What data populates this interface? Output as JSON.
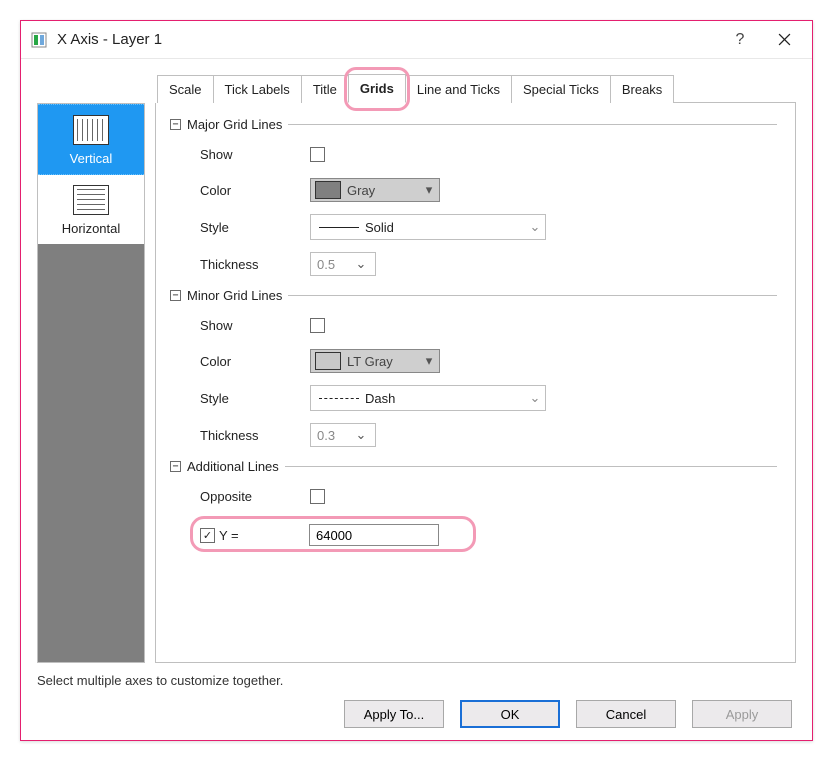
{
  "window": {
    "title": "X Axis - Layer 1"
  },
  "tabs": {
    "scale": "Scale",
    "tick_labels": "Tick Labels",
    "title": "Title",
    "grids": "Grids",
    "line_and_ticks": "Line and Ticks",
    "special_ticks": "Special Ticks",
    "breaks": "Breaks"
  },
  "sidebar": {
    "vertical": "Vertical",
    "horizontal": "Horizontal"
  },
  "groups": {
    "major": {
      "title": "Major Grid Lines",
      "show_label": "Show",
      "show_checked": false,
      "color_label": "Color",
      "color_name": "Gray",
      "color_hex": "#808080",
      "style_label": "Style",
      "style_name": "Solid",
      "thickness_label": "Thickness",
      "thickness_value": "0.5"
    },
    "minor": {
      "title": "Minor Grid Lines",
      "show_label": "Show",
      "show_checked": false,
      "color_label": "Color",
      "color_name": "LT Gray",
      "color_hex": "#c8c8c8",
      "style_label": "Style",
      "style_name": "Dash",
      "thickness_label": "Thickness",
      "thickness_value": "0.3"
    },
    "additional": {
      "title": "Additional Lines",
      "opposite_label": "Opposite",
      "opposite_checked": false,
      "y_label": "Y =",
      "y_checked": true,
      "y_value": "64000"
    }
  },
  "hint": "Select multiple axes to customize together.",
  "buttons": {
    "apply_to": "Apply To...",
    "ok": "OK",
    "cancel": "Cancel",
    "apply": "Apply"
  }
}
